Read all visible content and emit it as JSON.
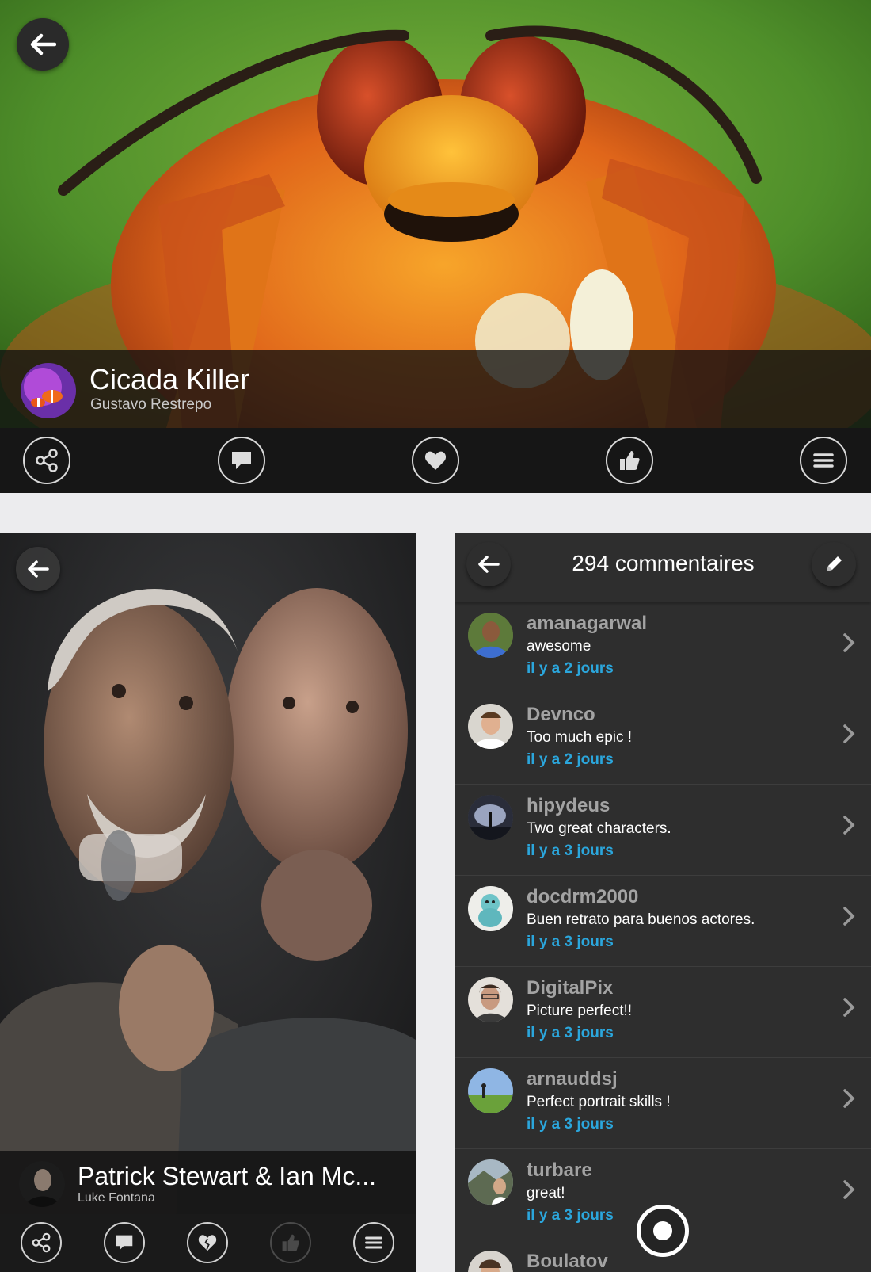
{
  "hero": {
    "title": "Cicada Killer",
    "author": "Gustavo Restrepo",
    "actions": [
      {
        "icon": "share-icon"
      },
      {
        "icon": "comment-icon"
      },
      {
        "icon": "heart-icon"
      },
      {
        "icon": "thumbs-up-icon"
      },
      {
        "icon": "menu-icon"
      }
    ]
  },
  "photo": {
    "title": "Patrick Stewart & Ian Mc...",
    "author": "Luke Fontana",
    "actions": [
      {
        "icon": "share-icon"
      },
      {
        "icon": "comment-icon"
      },
      {
        "icon": "broken-heart-icon"
      },
      {
        "icon": "thumbs-up-icon"
      },
      {
        "icon": "menu-icon"
      }
    ]
  },
  "comments": {
    "count_label": "294 commentaires",
    "items": [
      {
        "user": "amanagarwal",
        "text": "awesome",
        "time": "il y a 2 jours"
      },
      {
        "user": "Devnco",
        "text": "Too much epic !",
        "time": "il y a 2 jours"
      },
      {
        "user": "hipydeus",
        "text": "Two great characters.",
        "time": "il y a 3 jours"
      },
      {
        "user": "docdrm2000",
        "text": "Buen retrato para buenos actores.",
        "time": "il y a 3 jours"
      },
      {
        "user": "DigitalPix",
        "text": "Picture perfect!!",
        "time": "il y a 3 jours"
      },
      {
        "user": "arnauddsj",
        "text": "Perfect portrait skills !",
        "time": "il y a 3 jours"
      },
      {
        "user": "turbare",
        "text": "great!",
        "time": "il y a 3 jours"
      },
      {
        "user": "Boulatov",
        "text": "",
        "time": ""
      }
    ]
  },
  "colors": {
    "accent_time": "#2ba6dc",
    "panel_dark": "#2e2e2e",
    "background": "#ececee"
  }
}
